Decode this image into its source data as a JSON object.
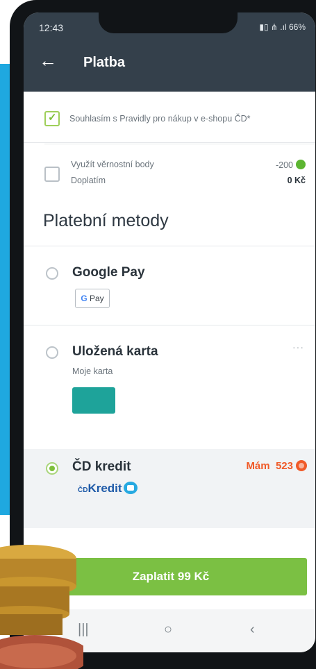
{
  "status_bar": {
    "time": "12:43",
    "icons_text": "▮▯ ⋔ .ıl 66%",
    "battery": "66%"
  },
  "app_bar": {
    "back_icon": "arrow-left-icon",
    "title": "Platba"
  },
  "agreement": {
    "checked": true,
    "text": "Souhlasím s Pravidly pro nákup v e-shopu ČD*"
  },
  "loyalty": {
    "checked": false,
    "label": "Využít věrnostní body",
    "points": "-200",
    "surcharge_label": "Doplatím",
    "surcharge_value": "0 Kč"
  },
  "payment_methods": {
    "title": "Platební metody",
    "items": [
      {
        "name": "Google Pay",
        "badge_g": "G",
        "badge_text": "Pay",
        "selected": false
      },
      {
        "name": "Uložená karta",
        "subtitle": "Moje karta",
        "more": "···",
        "selected": false
      },
      {
        "name": "ČD kredit",
        "logo_prefix": "ČD",
        "logo_text": "Kredit",
        "balance_label": "Mám",
        "balance_value": "523",
        "selected": true
      }
    ]
  },
  "pay_button": {
    "label": "Zaplatit 99 Kč"
  },
  "nav_bar": {
    "recents": "|||",
    "home": "○",
    "back": "‹"
  },
  "colors": {
    "accent_green": "#7bc043",
    "header": "#34404b",
    "credit_orange": "#f05a28",
    "kredit_blue": "#1e5aa8"
  }
}
